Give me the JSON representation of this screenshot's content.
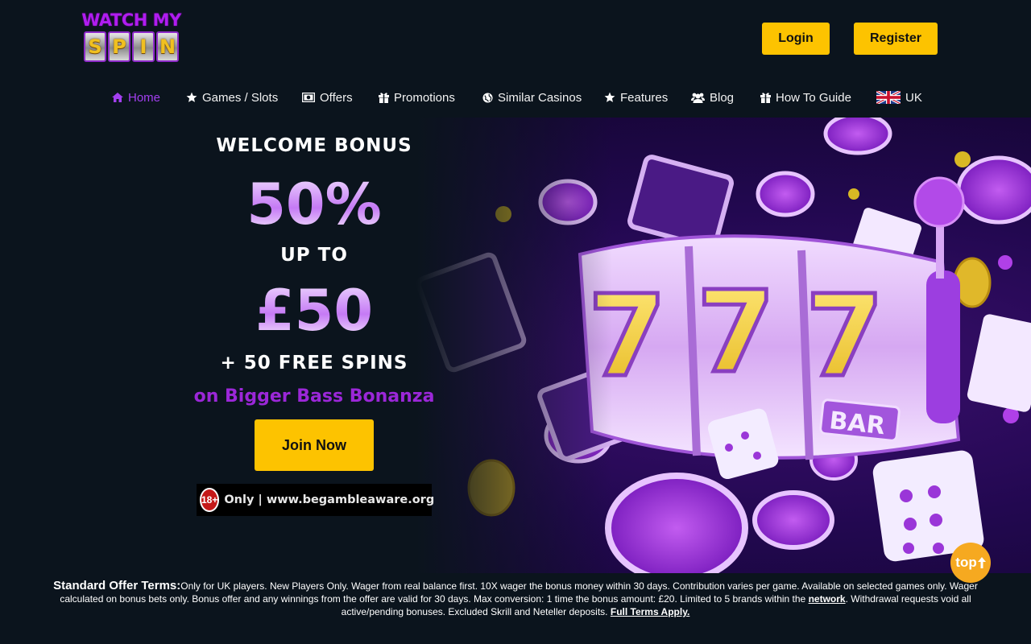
{
  "header": {
    "logo_top": "WATCH MY",
    "logo_letters": [
      "S",
      "P",
      "I",
      "N"
    ],
    "login_label": "Login",
    "register_label": "Register"
  },
  "nav": {
    "items": [
      {
        "label": "Home",
        "icon": "home-icon",
        "active": true
      },
      {
        "label": "Games / Slots",
        "icon": "star-icon"
      },
      {
        "label": "Offers",
        "icon": "money-icon"
      },
      {
        "label": "Promotions",
        "icon": "gift-icon"
      },
      {
        "label": "Similar Casinos",
        "icon": "globe-icon"
      },
      {
        "label": "Features",
        "icon": "star-icon"
      },
      {
        "label": "Blog",
        "icon": "users-icon"
      },
      {
        "label": "How To Guide",
        "icon": "gift-icon"
      },
      {
        "label": "UK",
        "icon": "uk-flag-icon"
      }
    ]
  },
  "hero": {
    "welcome": "WELCOME BONUS",
    "percent": "50%",
    "up_to": "UP TO",
    "amount": "£50",
    "spins": "+ 50 FREE SPINS",
    "game": "on Bigger Bass Bonanza",
    "join_label": "Join Now",
    "age_badge": "18+",
    "gamble_text": "Only | www.begambleaware.org",
    "accent_color": "#9b27d8",
    "button_color": "#fdc300"
  },
  "terms": {
    "label": "Standard Offer Terms:",
    "text_part1": "Only for UK players. New Players Only. Wager from real balance first. 10X wager the bonus money within 30 days. Contribution varies per game. Available on selected games only. Wager calculated on bonus bets only. Bonus offer and any winnings from the offer are valid for 30 days. Max conversion: 1 time the bonus amount: £20. Limited to 5 brands within the ",
    "network_link": "network",
    "text_part2": ". Withdrawal requests void all active/pending bonuses. Excluded Skrill and Neteller deposits. ",
    "full_terms_link": "Full Terms Apply."
  },
  "top_button": "top"
}
